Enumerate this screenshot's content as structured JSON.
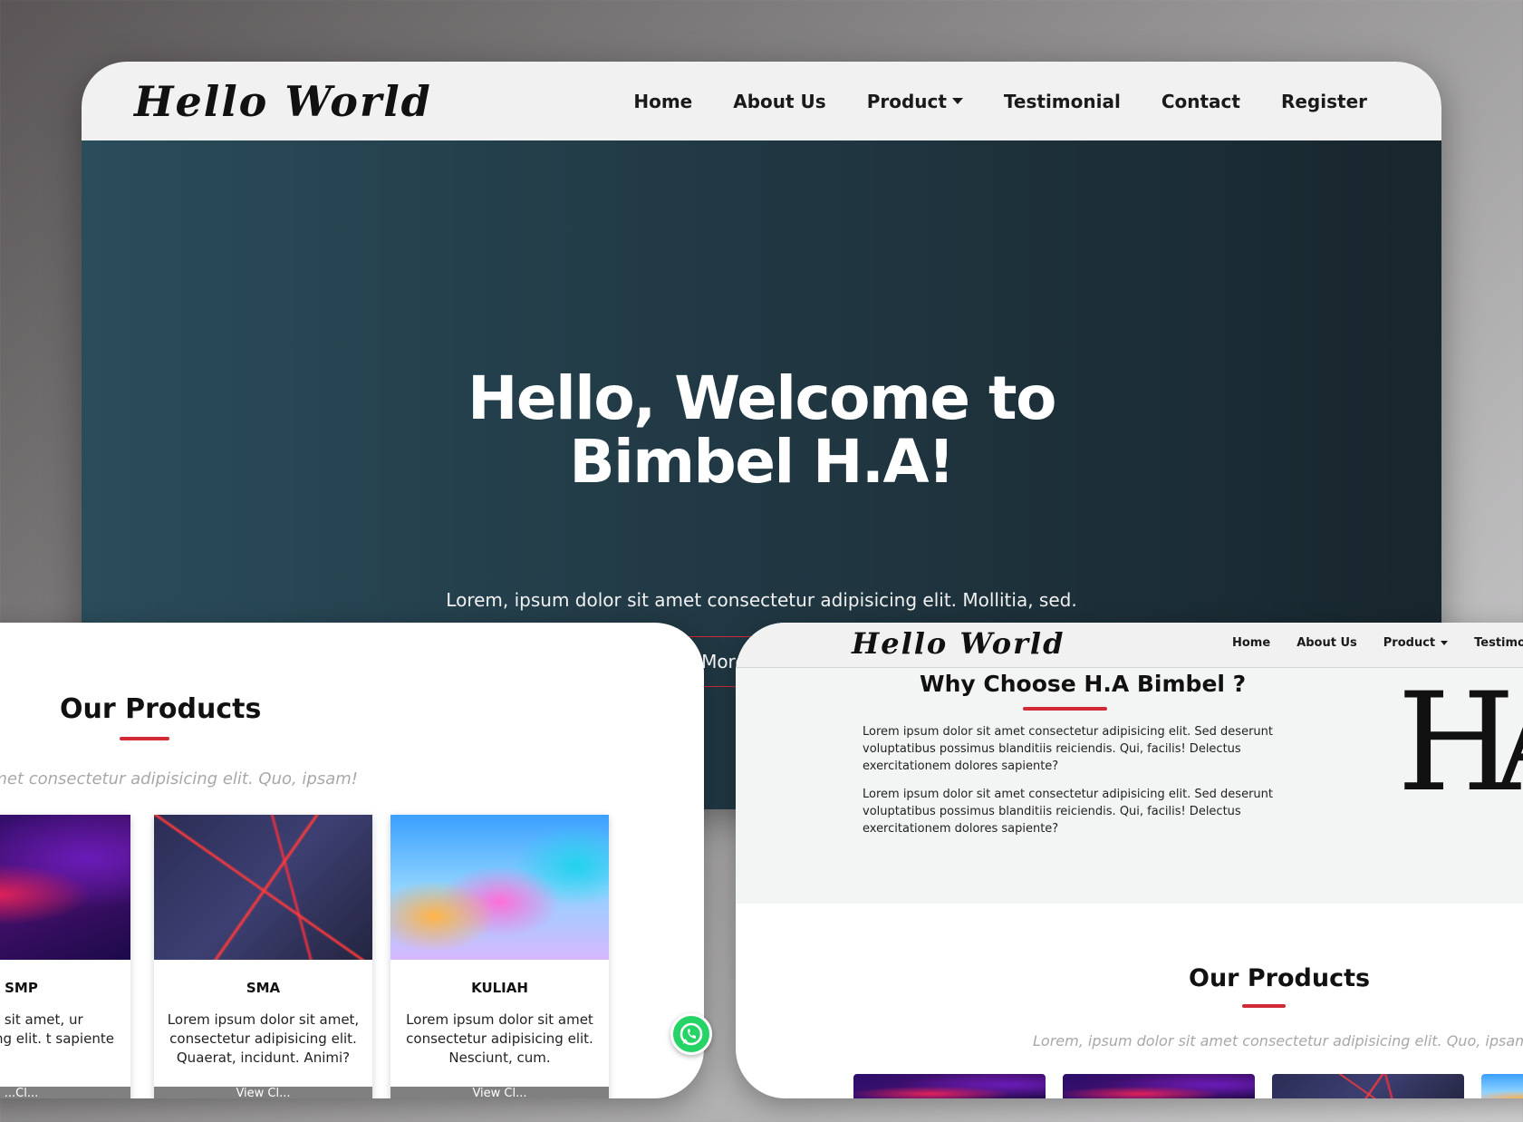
{
  "main": {
    "logo": "Hello World",
    "nav": [
      "Home",
      "About Us",
      "Product",
      "Testimonial",
      "Contact",
      "Register"
    ],
    "hero": {
      "title_line1": "Hello, Welcome to",
      "title_line2": "Bimbel H.A!",
      "subtitle": "Lorem, ipsum dolor sit amet consectetur adipisicing elit. Mollitia, sed.",
      "button": "More Product"
    },
    "colors": {
      "accent": "#d12a36",
      "nav_bg": "#f1f1f1",
      "hero_bg": "#223b47"
    }
  },
  "left": {
    "title": "Our Products",
    "subtitle": "olor sit amet consectetur adipisicing elit. Quo, ipsam!",
    "cards": [
      {
        "title": "SMP",
        "desc": "um dolor sit amet, ur adipisicing elit. t sapiente veniam?",
        "button": "...Cl...",
        "image": "space-nebula"
      },
      {
        "title": "SMA",
        "desc": "Lorem ipsum dolor sit amet, consectetur adipisicing elit. Quaerat, incidunt. Animi?",
        "button": "View Cl...",
        "image": "red-neon-triangles"
      },
      {
        "title": "KULIAH",
        "desc": "Lorem ipsum dolor sit amet consectetur adipisicing elit. Nesciunt, cum.",
        "button": "View Cl...",
        "image": "holographic-gradient"
      }
    ],
    "whatsapp_icon": "whatsapp-icon"
  },
  "right": {
    "logo": "Hello World",
    "nav": [
      "Home",
      "About Us",
      "Product",
      "Testimonial"
    ],
    "why_title": "Why Choose H.A Bimbel ?",
    "why_paragraphs": [
      "Lorem ipsum dolor sit amet consectetur adipisicing elit. Sed deserunt voluptatibus possimus blanditiis reiciendis. Qui, facilis! Delectus exercitationem dolores sapiente?",
      "Lorem ipsum dolor sit amet consectetur adipisicing elit. Sed deserunt voluptatibus possimus blanditiis reiciendis. Qui, facilis! Delectus exercitationem dolores sapiente?"
    ],
    "ha_logo": "HA",
    "products_title": "Our Products",
    "products_subtitle": "Lorem, ipsum dolor sit amet consectetur adipisicing elit. Quo, ipsam!"
  }
}
